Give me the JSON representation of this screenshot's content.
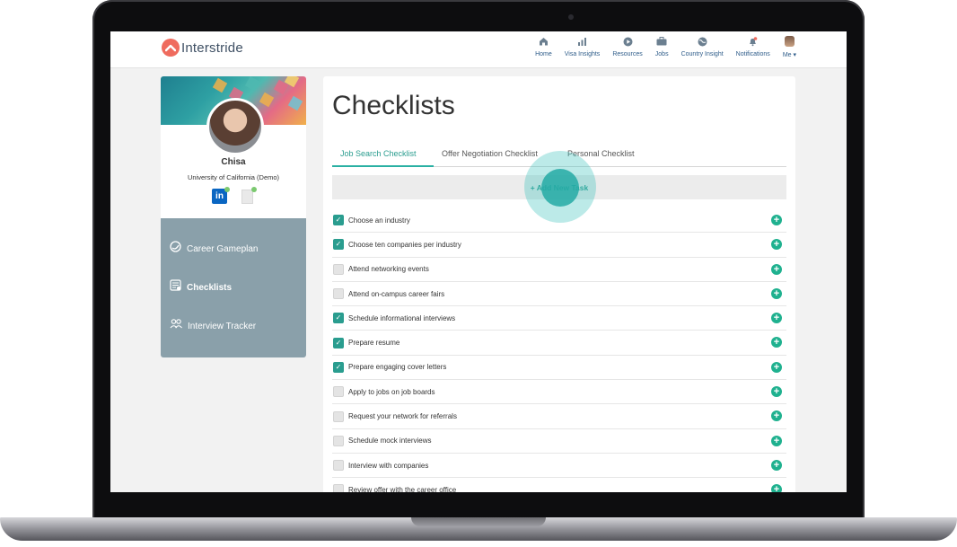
{
  "brand": {
    "name": "Interstride",
    "accent": "#2a9d8f",
    "logo_color": "#ef6b5e"
  },
  "nav": {
    "items": [
      {
        "label": "Home",
        "icon": "home-icon"
      },
      {
        "label": "Visa Insights",
        "icon": "bar-chart-icon"
      },
      {
        "label": "Resources",
        "icon": "play-icon"
      },
      {
        "label": "Jobs",
        "icon": "briefcase-icon"
      },
      {
        "label": "Country Insight",
        "icon": "globe-icon"
      },
      {
        "label": "Notifications",
        "icon": "bell-icon"
      },
      {
        "label": "Me ▾",
        "icon": "avatar"
      }
    ]
  },
  "profile": {
    "name": "Chisa",
    "school": "University of California (Demo)"
  },
  "sidebar": {
    "items": [
      {
        "label": "Career Gameplan",
        "icon": "gameplan-icon"
      },
      {
        "label": "Checklists",
        "icon": "checklist-icon",
        "active": true
      },
      {
        "label": "Interview Tracker",
        "icon": "people-icon"
      }
    ]
  },
  "main": {
    "title": "Checklists",
    "tabs": [
      {
        "label": "Job Search Checklist",
        "active": true
      },
      {
        "label": "Offer Negotiation Checklist"
      },
      {
        "label": "Personal Checklist"
      }
    ],
    "add_task_label": "+ Add New Task",
    "tasks": [
      {
        "label": "Choose an industry",
        "checked": true
      },
      {
        "label": "Choose ten companies per industry",
        "checked": true
      },
      {
        "label": "Attend networking events",
        "checked": false
      },
      {
        "label": "Attend on-campus career fairs",
        "checked": false
      },
      {
        "label": "Schedule informational interviews",
        "checked": true
      },
      {
        "label": "Prepare resume",
        "checked": true
      },
      {
        "label": "Prepare engaging cover letters",
        "checked": true
      },
      {
        "label": "Apply to jobs on job boards",
        "checked": false
      },
      {
        "label": "Request your network for referrals",
        "checked": false
      },
      {
        "label": "Schedule mock interviews",
        "checked": false
      },
      {
        "label": "Interview with companies",
        "checked": false
      },
      {
        "label": "Review offer with the career office",
        "checked": false
      }
    ]
  }
}
